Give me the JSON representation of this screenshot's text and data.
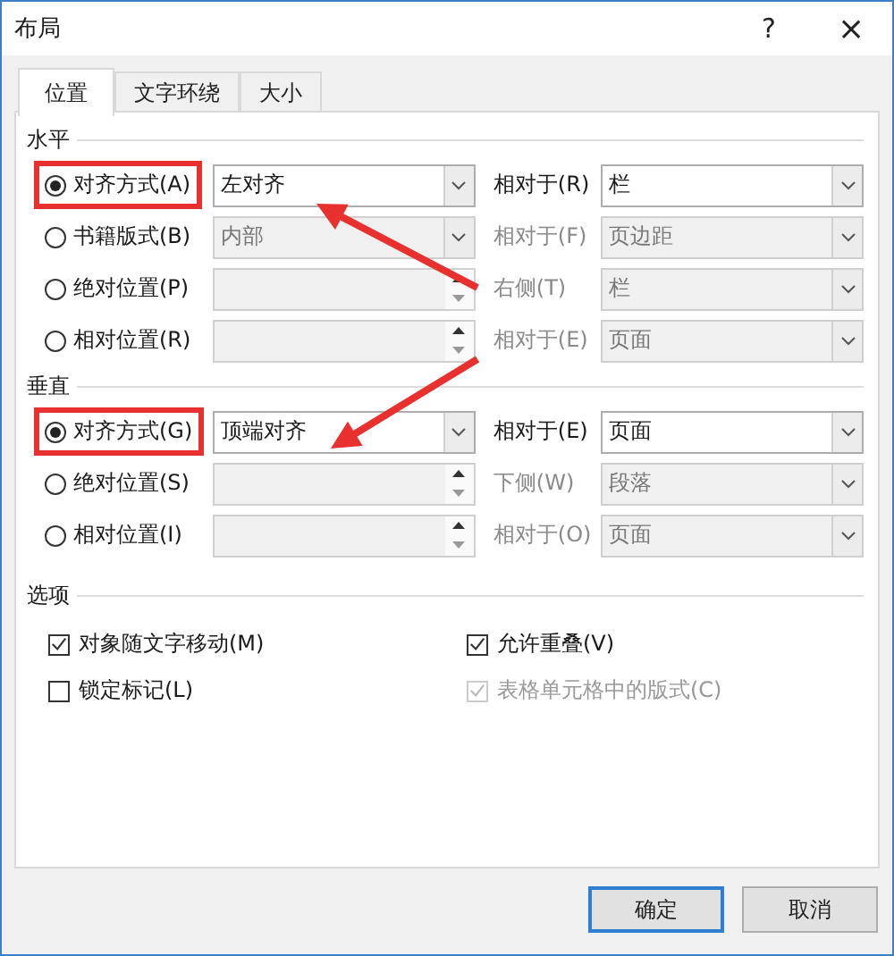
{
  "window": {
    "title": "布局",
    "help": "?",
    "close": "×"
  },
  "tabs": [
    {
      "label": "位置",
      "selected": true
    },
    {
      "label": "文字环绕",
      "selected": false
    },
    {
      "label": "大小",
      "selected": false
    }
  ],
  "sections": [
    {
      "title": "水平",
      "rows": [
        {
          "label": "对齐方式(A)",
          "selected": true,
          "highlighted": true,
          "input": {
            "kind": "dropdown",
            "value": "左对齐",
            "disabled": false
          },
          "relative_label": "相对于(R)",
          "relative_disabled": false,
          "relative_value": "栏"
        },
        {
          "label": "书籍版式(B)",
          "selected": false,
          "highlighted": false,
          "input": {
            "kind": "dropdown",
            "value": "内部",
            "disabled": true
          },
          "relative_label": "相对于(F)",
          "relative_disabled": true,
          "relative_value": "页边距"
        },
        {
          "label": "绝对位置(P)",
          "selected": false,
          "highlighted": false,
          "input": {
            "kind": "spinner",
            "disabled": true
          },
          "relative_label": "右侧(T)",
          "relative_disabled": true,
          "relative_value": "栏"
        },
        {
          "label": "相对位置(R)",
          "selected": false,
          "highlighted": false,
          "input": {
            "kind": "spinner",
            "disabled": true
          },
          "relative_label": "相对于(E)",
          "relative_disabled": true,
          "relative_value": "页面"
        }
      ]
    },
    {
      "title": "垂直",
      "rows": [
        {
          "label": "对齐方式(G)",
          "selected": true,
          "highlighted": true,
          "input": {
            "kind": "dropdown",
            "value": "顶端对齐",
            "disabled": false
          },
          "relative_label": "相对于(E)",
          "relative_disabled": false,
          "relative_value": "页面"
        },
        {
          "label": "绝对位置(S)",
          "selected": false,
          "highlighted": false,
          "input": {
            "kind": "spinner",
            "disabled": true
          },
          "relative_label": "下侧(W)",
          "relative_disabled": true,
          "relative_value": "段落"
        },
        {
          "label": "相对位置(I)",
          "selected": false,
          "highlighted": false,
          "input": {
            "kind": "spinner",
            "disabled": true
          },
          "relative_label": "相对于(O)",
          "relative_disabled": true,
          "relative_value": "页面"
        }
      ]
    }
  ],
  "options": {
    "title": "选项",
    "checkboxes": [
      {
        "label": "对象随文字移动(M)",
        "checked": true,
        "disabled": false
      },
      {
        "label": "允许重叠(V)",
        "checked": true,
        "disabled": false
      },
      {
        "label": "锁定标记(L)",
        "checked": false,
        "disabled": false
      },
      {
        "label": "表格单元格中的版式(C)",
        "checked": true,
        "disabled": true
      }
    ]
  },
  "buttons": [
    {
      "label": "确定",
      "default": true
    },
    {
      "label": "取消",
      "default": false
    }
  ],
  "annotations": [
    {
      "kind": "arrow"
    },
    {
      "kind": "arrow"
    }
  ]
}
